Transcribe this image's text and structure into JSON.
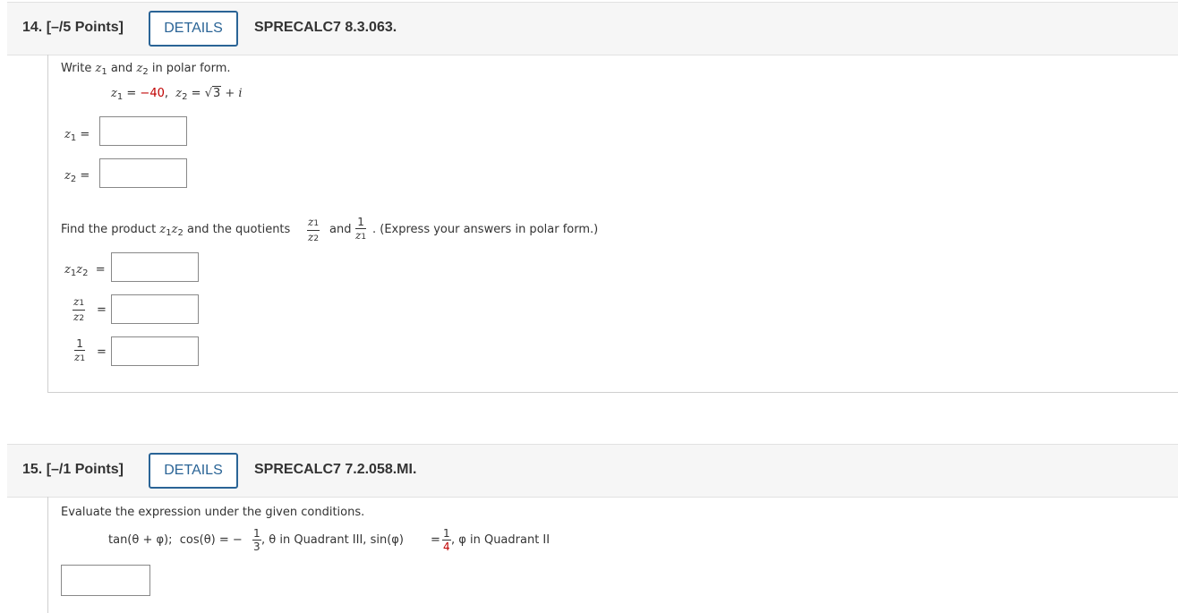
{
  "q14": {
    "number": "14.",
    "points": "[–/5 Points]",
    "details_label": "DETAILS",
    "code": "SPRECALC7 8.3.063.",
    "prompt_write": "Write",
    "prompt_and": "and",
    "prompt_in_polar": "in polar form.",
    "z1_value": "−40",
    "z2_sqrt": "3",
    "z2_plus_i": "+ i",
    "find_prefix": "Find the product",
    "find_and_quotients": "and the quotients",
    "find_and": "and",
    "find_suffix": ". (Express your answers in polar form.)",
    "var_z": "z",
    "sub1": "1",
    "sub2": "2",
    "eq": "=",
    "one": "1"
  },
  "q15": {
    "number": "15.",
    "points": "[–/1 Points]",
    "details_label": "DETAILS",
    "code": "SPRECALC7 7.2.058.MI.",
    "prompt": "Evaluate the expression under the given conditions.",
    "expr_tan": "tan(θ + φ);",
    "expr_cos": "cos(θ) = −",
    "frac1_num": "1",
    "frac1_den": "3",
    "cond_theta": ", θ in Quadrant III, sin(φ)",
    "eq": "=",
    "frac2_num": "1",
    "frac2_den": "4",
    "cond_phi": ", φ in Quadrant II"
  },
  "colors": {
    "accent": "#2a6496",
    "red_value": "#c00000",
    "header_bg": "#f6f6f6"
  }
}
